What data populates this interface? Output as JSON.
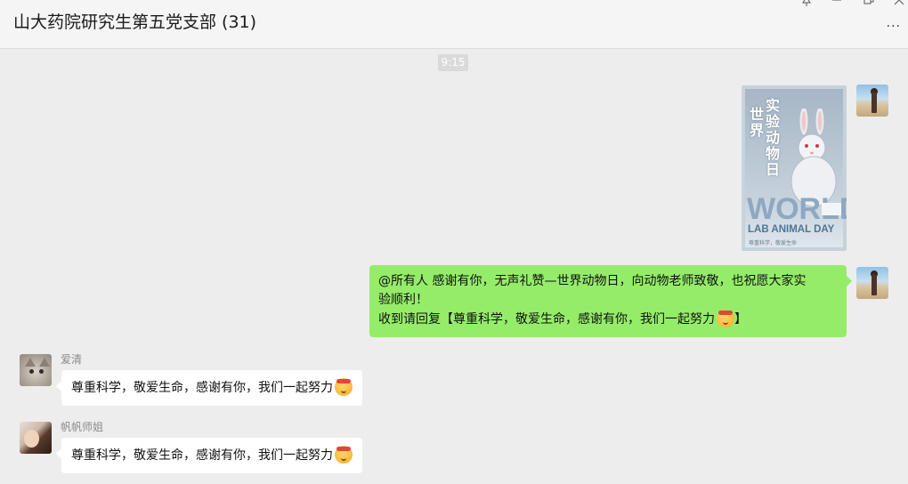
{
  "window": {
    "title": "山大药院研究生第五党支部 (31)",
    "pin_icon": "pin-icon",
    "minimize_icon": "minimize-icon",
    "maximize_icon": "maximize-icon",
    "close_icon": "close-icon",
    "more_label": "···"
  },
  "chat": {
    "timestamp": "9:15",
    "messages": [
      {
        "sender": "self",
        "type": "image",
        "image": {
          "title_vertical_right": "实验动物日",
          "title_vertical_left": "世界",
          "world_text": "WORLD",
          "lab_text": "LAB ANIMAL DAY",
          "caption": "尊重科学，敬爱生命"
        }
      },
      {
        "sender": "self",
        "type": "text",
        "line1": "@所有人 感谢有你，无声礼赞—世界动物日，向动物老师致敬，也祝愿大家实",
        "line2": "验顺利！",
        "line3": "收到请回复【尊重科学，敬爱生命，感谢有你，我们一起努力",
        "line3_end": "】",
        "emoji": "muscle-headband-emoji"
      },
      {
        "sender": "爱清",
        "type": "text",
        "text": "尊重科学，敬爱生命，感谢有你，我们一起努力",
        "emoji": "muscle-headband-emoji"
      },
      {
        "sender": "帆帆师姐",
        "type": "text",
        "text": "尊重科学，敬爱生命，感谢有你，我们一起努力",
        "emoji": "muscle-headband-emoji"
      }
    ]
  },
  "colors": {
    "self_bubble": "#95ec69",
    "other_bubble": "#ffffff",
    "background": "#ededed"
  }
}
